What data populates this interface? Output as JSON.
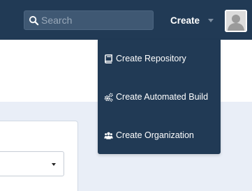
{
  "header": {
    "search": {
      "placeholder": "Search",
      "value": ""
    },
    "create_label": "Create"
  },
  "create_menu": {
    "items": [
      {
        "label": "Create Repository",
        "icon": "book-icon"
      },
      {
        "label": "Create Automated Build",
        "icon": "cogs-icon"
      },
      {
        "label": "Create Organization",
        "icon": "users-icon"
      }
    ]
  },
  "colors": {
    "topbar": "#213a55",
    "content_background": "#e9eef7"
  }
}
